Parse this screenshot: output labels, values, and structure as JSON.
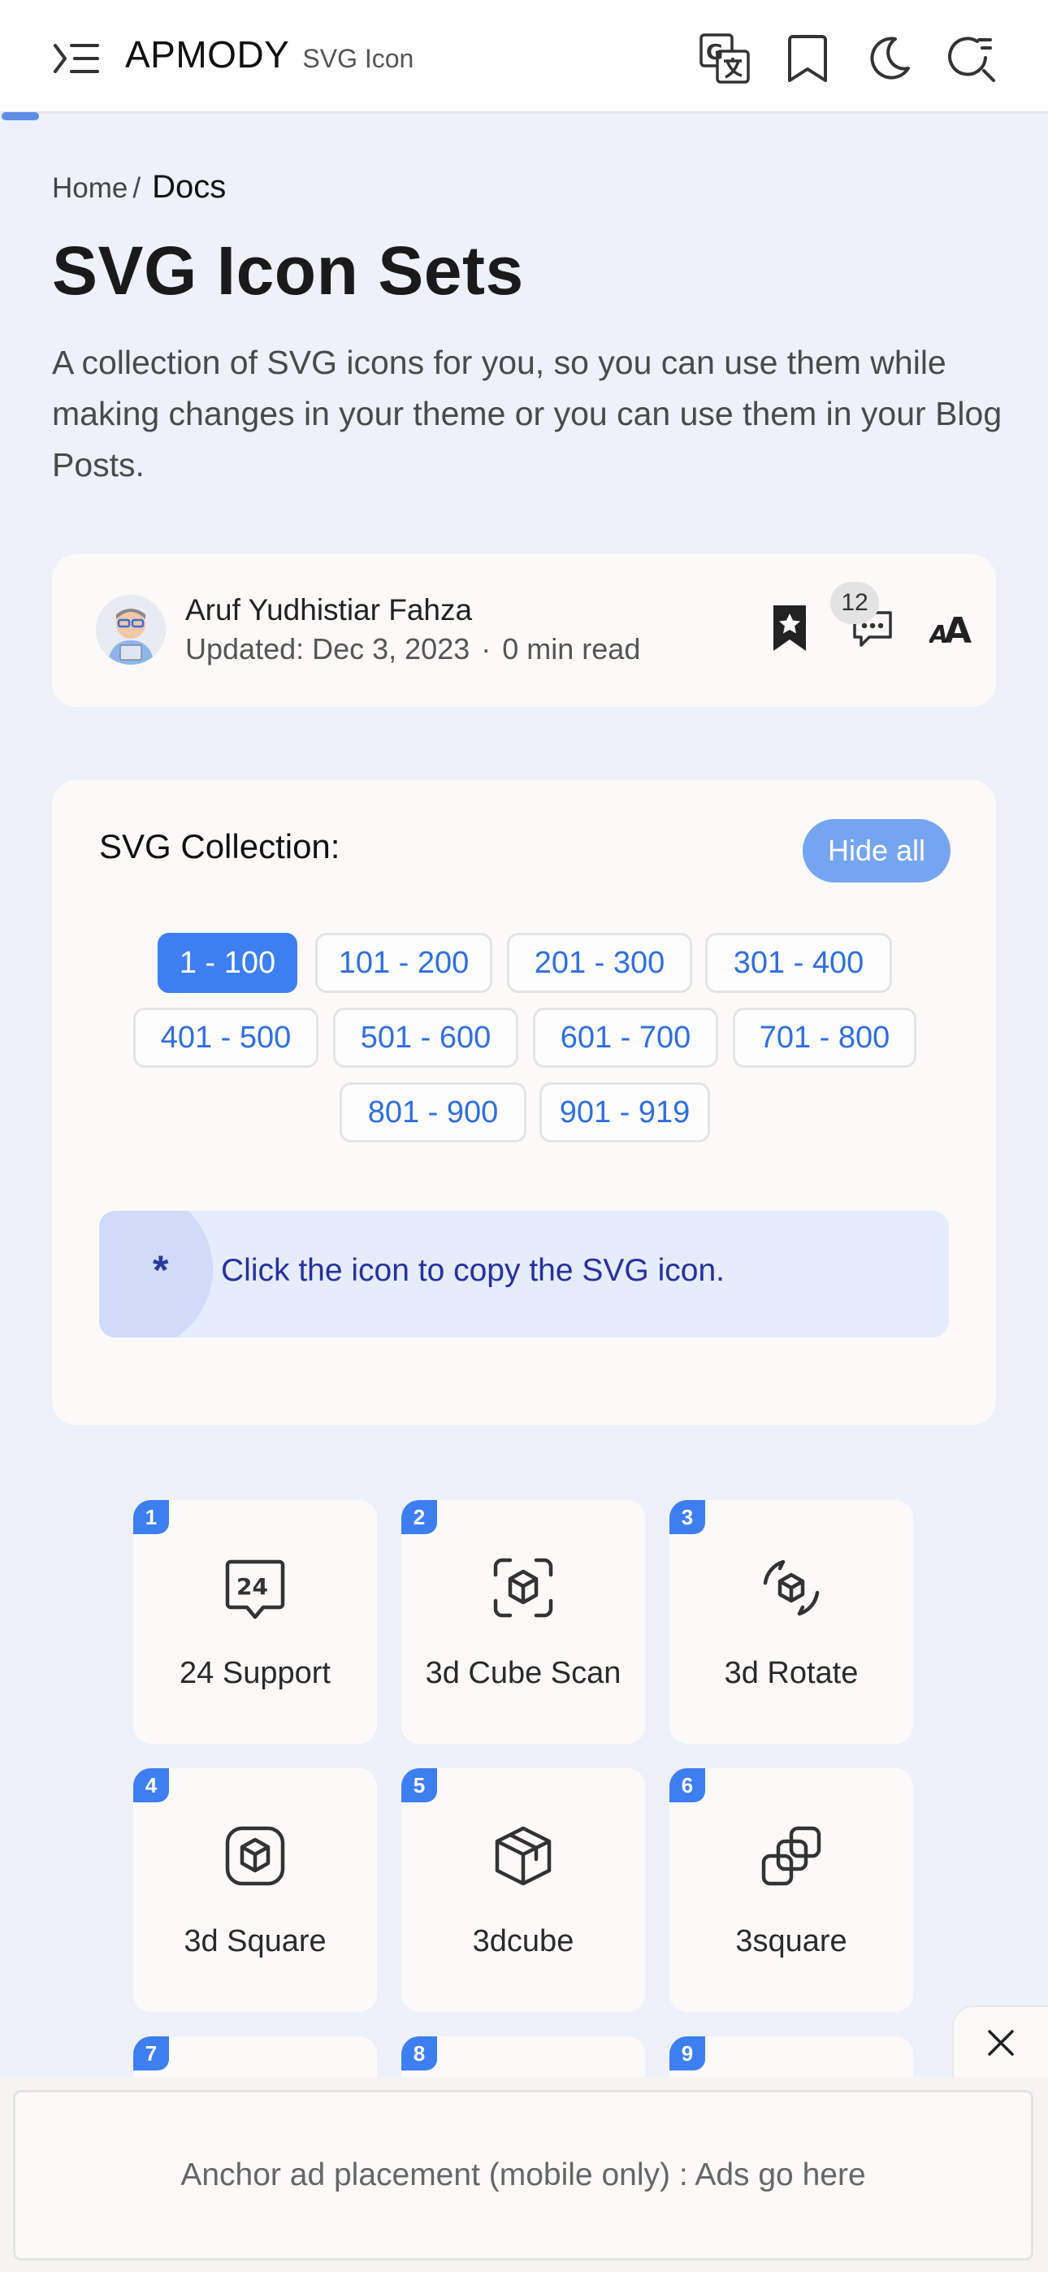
{
  "header": {
    "brand": "APMODY",
    "brand_sub": "SVG Icon",
    "icons": [
      "menu-icon",
      "translate-icon",
      "bookmark-icon",
      "moon-icon",
      "search-icon"
    ]
  },
  "breadcrumb": {
    "home": "Home",
    "separator": "/",
    "current": "Docs"
  },
  "page": {
    "title": "SVG Icon Sets",
    "description": "A collection of SVG icons for you, so you can use them while making changes in your theme or you can use them in your Blog Posts."
  },
  "author": {
    "name": "Aruf Yudhistiar Fahza",
    "updated": "Updated: Dec 3, 2023",
    "dot": "·",
    "read_time": "0 min read",
    "comment_count": "12"
  },
  "collection": {
    "title": "SVG Collection:",
    "hide_label": "Hide all",
    "ranges": [
      "1 - 100",
      "101 - 200",
      "201 - 300",
      "301 - 400",
      "401 - 500",
      "501 - 600",
      "601 - 700",
      "701 - 800",
      "801 - 900",
      "901 - 919"
    ],
    "active_range": "1 - 100",
    "hint_star": "*",
    "hint": "Click the icon to copy the SVG icon."
  },
  "icons": [
    {
      "num": "1",
      "label": "24 Support",
      "icon": "24-support-icon"
    },
    {
      "num": "2",
      "label": "3d Cube Scan",
      "icon": "3d-cube-scan-icon"
    },
    {
      "num": "3",
      "label": "3d Rotate",
      "icon": "3d-rotate-icon"
    },
    {
      "num": "4",
      "label": "3d Square",
      "icon": "3d-square-icon"
    },
    {
      "num": "5",
      "label": "3dcube",
      "icon": "3dcube-icon"
    },
    {
      "num": "6",
      "label": "3square",
      "icon": "3square-icon"
    },
    {
      "num": "7",
      "label": "",
      "icon": ""
    },
    {
      "num": "8",
      "label": "",
      "icon": ""
    },
    {
      "num": "9",
      "label": "",
      "icon": ""
    }
  ],
  "ad": {
    "text": "Anchor ad placement (mobile only) : Ads go here"
  },
  "colors": {
    "accent": "#3d7ff0",
    "page_bg": "#eef1fa",
    "card_bg": "#fbfaf8",
    "hint_text": "#25329c"
  }
}
